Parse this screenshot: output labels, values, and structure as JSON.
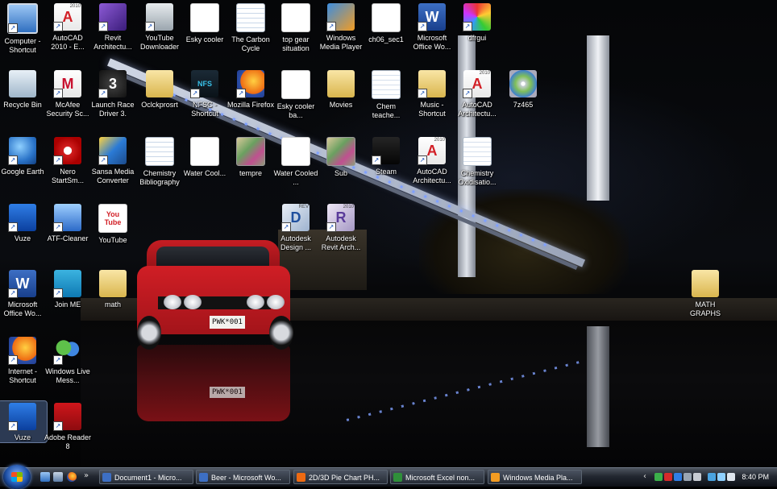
{
  "desktop": {
    "icons": [
      {
        "id": "computer",
        "label": "Computer - Shortcut",
        "icon": "computer-icon",
        "shortcut": true
      },
      {
        "id": "autocad2010",
        "label": "AutoCAD 2010 - E...",
        "icon": "autocad-icon",
        "shortcut": true,
        "text": "A",
        "text2": "2010"
      },
      {
        "id": "revit",
        "label": "Revit Architectu...",
        "icon": "revit-icon",
        "shortcut": true
      },
      {
        "id": "ytdownloader",
        "label": "YouTube Downloader",
        "icon": "youtube-downloader-icon",
        "shortcut": true
      },
      {
        "id": "eskycooler",
        "label": "Esky cooler",
        "icon": "blank-document-icon",
        "shortcut": false
      },
      {
        "id": "carboncycle",
        "label": "The Carbon Cycle",
        "icon": "document-icon",
        "shortcut": false
      },
      {
        "id": "topgear",
        "label": "top gear situation",
        "icon": "blank-document-icon",
        "shortcut": false
      },
      {
        "id": "wmp",
        "label": "Windows Media Player",
        "icon": "media-player-icon",
        "shortcut": true
      },
      {
        "id": "ch06",
        "label": "ch06_sec1",
        "icon": "pdf-document-icon",
        "shortcut": false
      },
      {
        "id": "msofficeword1",
        "label": "Microsoft Office Wo...",
        "icon": "word-icon",
        "shortcut": true,
        "text": "W"
      },
      {
        "id": "dfrgui",
        "label": "dfrgui",
        "icon": "defrag-icon",
        "shortcut": true
      },
      {
        "id": "recyclebin",
        "label": "Recycle Bin",
        "icon": "recycle-bin-icon",
        "shortcut": false
      },
      {
        "id": "mcafee",
        "label": "McAfee Security Sc...",
        "icon": "mcafee-icon",
        "shortcut": true,
        "text": "M"
      },
      {
        "id": "launchrace",
        "label": "Launch Race Driver 3.",
        "icon": "race-driver-icon",
        "shortcut": true,
        "text": "3"
      },
      {
        "id": "oclckprosrt",
        "label": "Oclckprosrt",
        "icon": "folder-icon",
        "shortcut": false
      },
      {
        "id": "nfsc",
        "label": "NFSC - Shortcut",
        "icon": "nfs-icon",
        "shortcut": true,
        "text": "NFS"
      },
      {
        "id": "mozfirefox",
        "label": "Mozilla Firefox",
        "icon": "firefox-icon",
        "shortcut": true
      },
      {
        "id": "eskycooler2",
        "label": "Esky cooler ba...",
        "icon": "blank-document-icon",
        "shortcut": false
      },
      {
        "id": "movies",
        "label": "Movies",
        "icon": "folder-icon",
        "shortcut": false
      },
      {
        "id": "chemteacher",
        "label": "Chem teache...",
        "icon": "word-document-icon",
        "shortcut": false
      },
      {
        "id": "music",
        "label": "Music - Shortcut",
        "icon": "folder-icon",
        "shortcut": true
      },
      {
        "id": "autocadarch1",
        "label": "AutoCAD Architectu...",
        "icon": "autocad-icon",
        "shortcut": true,
        "text": "A",
        "text2": "2010"
      },
      {
        "id": "7z465",
        "label": "7z465",
        "icon": "installer-disc-icon",
        "shortcut": false
      },
      {
        "id": "googleearth",
        "label": "Google Earth",
        "icon": "google-earth-icon",
        "shortcut": true
      },
      {
        "id": "nero",
        "label": "Nero StartSm...",
        "icon": "nero-icon",
        "shortcut": true
      },
      {
        "id": "sansa",
        "label": "Sansa Media Converter",
        "icon": "sansa-icon",
        "shortcut": true
      },
      {
        "id": "chembib",
        "label": "Chemistry Bibliography",
        "icon": "document-icon",
        "shortcut": false
      },
      {
        "id": "watercool1",
        "label": "Water Cool...",
        "icon": "blank-document-icon",
        "shortcut": false
      },
      {
        "id": "tempre",
        "label": "tempre",
        "icon": "image-icon",
        "shortcut": false
      },
      {
        "id": "watercooled",
        "label": "Water Cooled ...",
        "icon": "blank-document-icon",
        "shortcut": false
      },
      {
        "id": "sub",
        "label": "Sub",
        "icon": "image-icon",
        "shortcut": false
      },
      {
        "id": "steam",
        "label": "Steam",
        "icon": "steam-icon",
        "shortcut": true
      },
      {
        "id": "autocadarch2",
        "label": "AutoCAD Architectu...",
        "icon": "autocad-icon",
        "shortcut": true,
        "text": "A",
        "text2": "2010"
      },
      {
        "id": "chemoxid",
        "label": "Chemistry Oxidisatio...",
        "icon": "word-document-icon",
        "shortcut": false
      },
      {
        "id": "vuze1",
        "label": "Vuze",
        "icon": "vuze-icon",
        "shortcut": true
      },
      {
        "id": "atfcleaner",
        "label": "ATF-Cleaner",
        "icon": "atf-cleaner-icon",
        "shortcut": true
      },
      {
        "id": "youtube",
        "label": "YouTube",
        "icon": "youtube-icon",
        "shortcut": false,
        "text": "You Tube"
      },
      {
        "id": "autodeskdesign",
        "label": "Autodesk Design ...",
        "icon": "autodesk-design-icon",
        "shortcut": true,
        "text": "D",
        "text2": "REV"
      },
      {
        "id": "autodeskrevit",
        "label": "Autodesk Revit Arch...",
        "icon": "autodesk-revit-icon",
        "shortcut": true,
        "text": "R",
        "text2": "2010"
      },
      {
        "id": "msofficeword2",
        "label": "Microsoft Office Wo...",
        "icon": "word-icon",
        "shortcut": true,
        "text": "W"
      },
      {
        "id": "joinme",
        "label": "Join ME",
        "icon": "join-me-icon",
        "shortcut": true
      },
      {
        "id": "math",
        "label": "math",
        "icon": "folder-icon",
        "shortcut": false
      },
      {
        "id": "mathgraphs",
        "label": "MATH GRAPHS",
        "icon": "folder-icon",
        "shortcut": false
      },
      {
        "id": "ie",
        "label": "Internet - Shortcut",
        "icon": "firefox-icon",
        "shortcut": true
      },
      {
        "id": "wlm",
        "label": "Windows Live Mess...",
        "icon": "messenger-icon",
        "shortcut": true
      },
      {
        "id": "vuze2",
        "label": "Vuze",
        "icon": "vuze-icon",
        "shortcut": true,
        "selected": true
      },
      {
        "id": "adobereader",
        "label": "Adobe Reader 8",
        "icon": "adobe-reader-icon",
        "shortcut": true
      }
    ],
    "wallpaper": {
      "plate": "PWK*001",
      "plate_reflection": "PWK*001"
    }
  },
  "taskbar": {
    "buttons": [
      {
        "label": "Document1 - Micro...",
        "icon": "word-icon",
        "color": "#3d6fc4"
      },
      {
        "label": "Beer - Microsoft Wo...",
        "icon": "word-icon",
        "color": "#3d6fc4"
      },
      {
        "label": "2D/3D Pie Chart PH...",
        "icon": "firefox-icon",
        "color": "#ee6a12"
      },
      {
        "label": "Microsoft Excel non...",
        "icon": "excel-icon",
        "color": "#2f8f3a"
      },
      {
        "label": "Windows Media Pla...",
        "icon": "media-player-icon",
        "color": "#f39c22"
      }
    ],
    "tray": {
      "clock": "8:40 PM"
    }
  }
}
